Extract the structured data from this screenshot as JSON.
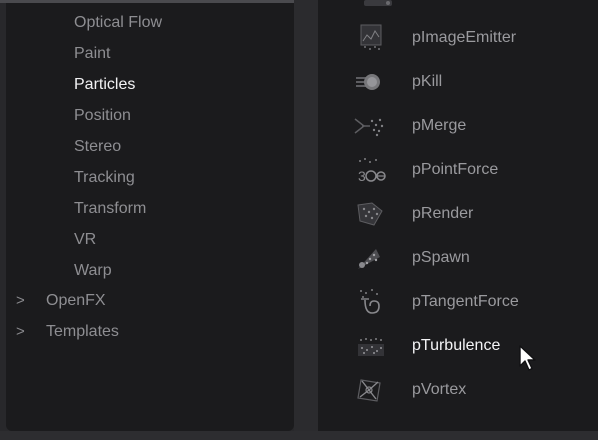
{
  "categories": [
    {
      "label": "Optical Flow"
    },
    {
      "label": "Paint"
    },
    {
      "label": "Particles",
      "selected": true
    },
    {
      "label": "Position"
    },
    {
      "label": "Stereo"
    },
    {
      "label": "Tracking"
    },
    {
      "label": "Transform"
    },
    {
      "label": "VR"
    },
    {
      "label": "Warp"
    }
  ],
  "groups": [
    {
      "label": "OpenFX",
      "collapsed": true
    },
    {
      "label": "Templates",
      "collapsed": true
    }
  ],
  "tools": [
    {
      "label": "pImageEmitter",
      "icon": "image-emitter-icon"
    },
    {
      "label": "pKill",
      "icon": "kill-icon"
    },
    {
      "label": "pMerge",
      "icon": "merge-icon"
    },
    {
      "label": "pPointForce",
      "icon": "point-force-icon"
    },
    {
      "label": "pRender",
      "icon": "render-icon"
    },
    {
      "label": "pSpawn",
      "icon": "spawn-icon"
    },
    {
      "label": "pTangentForce",
      "icon": "tangent-force-icon"
    },
    {
      "label": "pTurbulence",
      "icon": "turbulence-icon",
      "hovered": true
    },
    {
      "label": "pVortex",
      "icon": "vortex-icon"
    }
  ],
  "colors": {
    "panel_bg": "#1b1b1d",
    "frame_bg": "#28282b",
    "text_muted": "#8e8e92",
    "text_selected": "#f2f2f4"
  }
}
